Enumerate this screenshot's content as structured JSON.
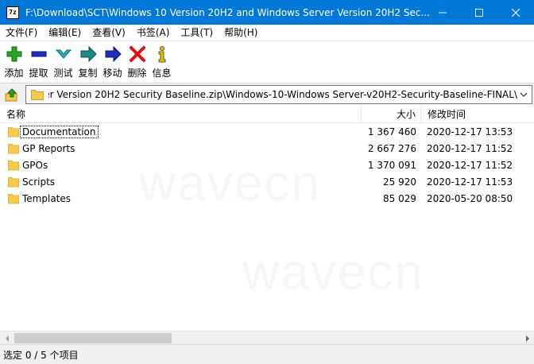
{
  "window": {
    "title": "F:\\Download\\SCT\\Windows 10 Version 20H2 and Windows Server Version 20H2 Sec...",
    "icon_text": "7z"
  },
  "menu": [
    {
      "label": "文件(F)"
    },
    {
      "label": "编辑(E)"
    },
    {
      "label": "查看(V)"
    },
    {
      "label": "书签(A)"
    },
    {
      "label": "工具(T)"
    },
    {
      "label": "帮助(H)"
    }
  ],
  "toolbar": [
    {
      "label": "添加",
      "icon": "add-icon",
      "color": "#2aa52a"
    },
    {
      "label": "提取",
      "icon": "extract-icon",
      "color": "#1b2fb8"
    },
    {
      "label": "测试",
      "icon": "test-icon",
      "color": "#1fb0c0"
    },
    {
      "label": "复制",
      "icon": "copy-icon",
      "color": "#1c8a8a"
    },
    {
      "label": "移动",
      "icon": "move-icon",
      "color": "#1b2fb8"
    },
    {
      "label": "删除",
      "icon": "delete-icon",
      "color": "#e01010"
    },
    {
      "label": "信息",
      "icon": "info-icon",
      "color": "#d8c21a"
    }
  ],
  "address": {
    "path": "F:\\Download\\SCT\\Windows 10 Version 20H2 and Windows Server Version 20H2 Security Baseline.zip\\Windows-10-Windows Server-v20H2-Security-Baseline-FINAL\\"
  },
  "columns": {
    "name": "名称",
    "size": "大小",
    "modified": "修改时间"
  },
  "files": [
    {
      "name": "Documentation",
      "size": "1 367 460",
      "modified": "2020-12-17 13:53"
    },
    {
      "name": "GP Reports",
      "size": "2 667 276",
      "modified": "2020-12-17 11:52"
    },
    {
      "name": "GPOs",
      "size": "1 370 091",
      "modified": "2020-12-17 11:52"
    },
    {
      "name": "Scripts",
      "size": "25 920",
      "modified": "2020-12-17 11:53"
    },
    {
      "name": "Templates",
      "size": "85 029",
      "modified": "2020-05-20 08:50"
    }
  ],
  "watermark": "wavecn",
  "status": {
    "text": "选定 0 / 5 个项目"
  },
  "colors": {
    "titlebar": "#0078d7",
    "folder": "#f6c94f"
  }
}
